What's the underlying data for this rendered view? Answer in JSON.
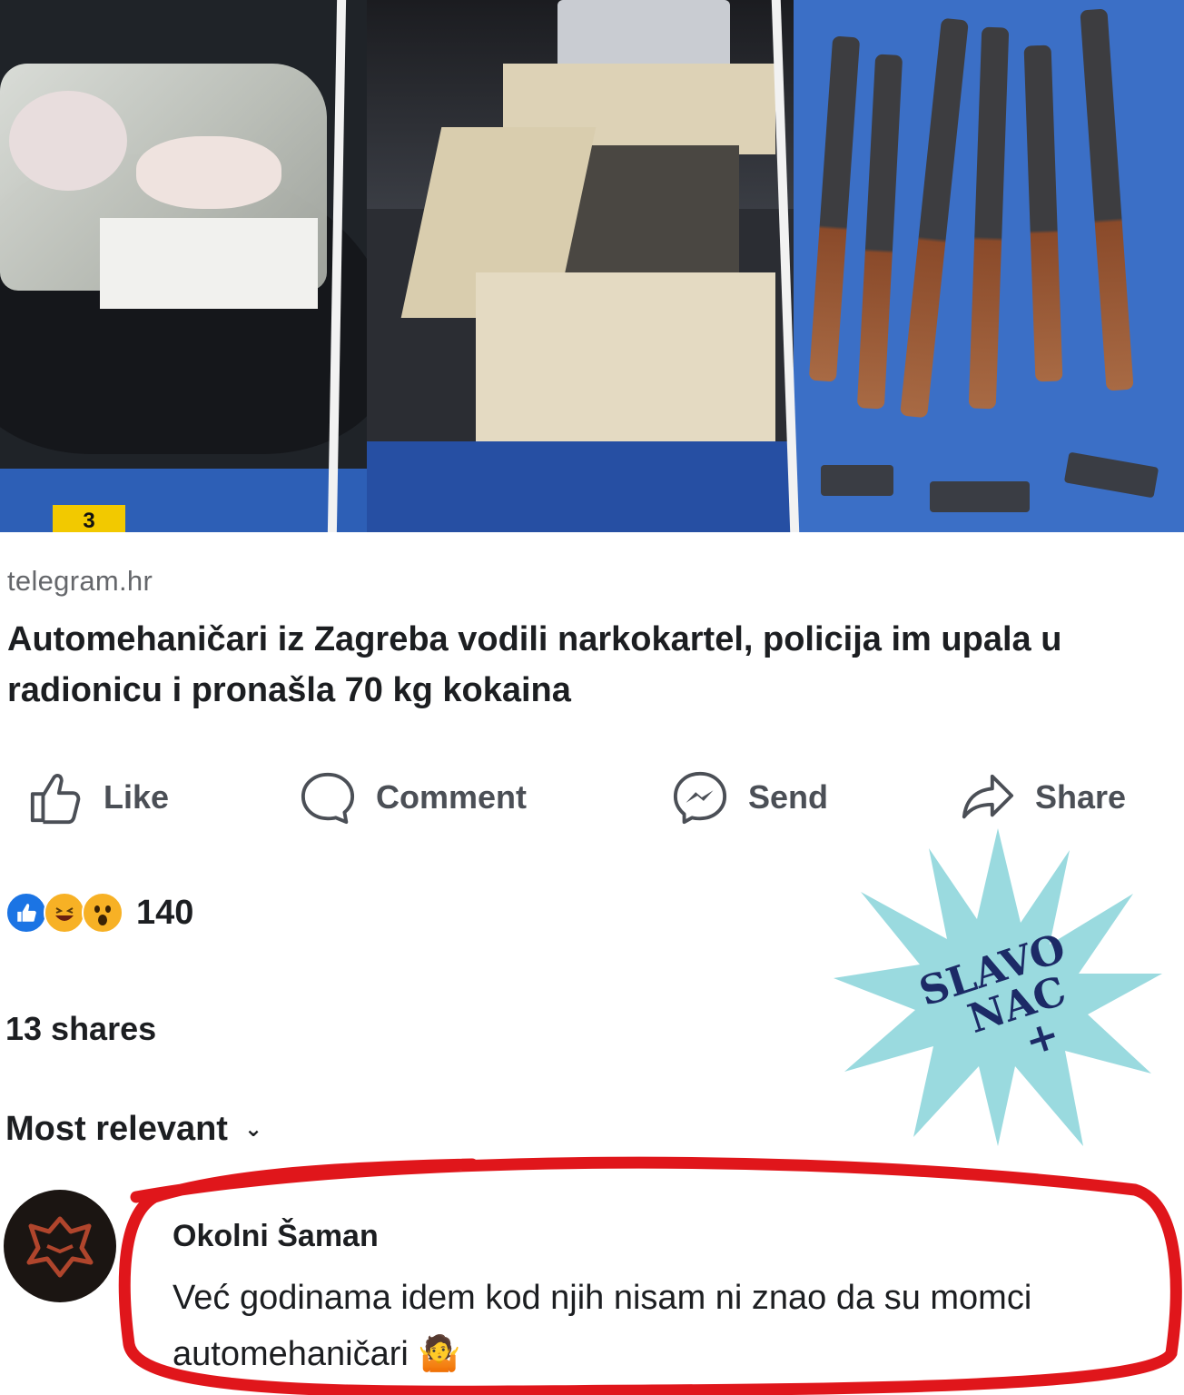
{
  "photo": {
    "evidence_tag": "3"
  },
  "link_preview": {
    "source": "telegram.hr",
    "headline": "Automehaničari iz Zagreba vodili narkokartel, policija im upala u radionicu i pronašla 70 kg kokaina"
  },
  "actions": {
    "like": "Like",
    "comment": "Comment",
    "send": "Send",
    "share": "Share"
  },
  "reactions": {
    "icons": [
      "like-reaction-icon",
      "haha-reaction-icon",
      "wow-reaction-icon"
    ],
    "count": "140"
  },
  "shares": "13 shares",
  "sort": {
    "label": "Most relevant"
  },
  "watermark": {
    "line1": "SLAVO",
    "line2": "NAC",
    "line3": "+",
    "color": "#8fd6dc"
  },
  "comment": {
    "author": "Okolni Šaman",
    "text": "Već godinama idem kod njih nisam ni znao da su momci automehaničari",
    "emoji": "🤷"
  },
  "colors": {
    "text": "#1c1e21",
    "muted": "#65676b",
    "like_blue": "#1b74e4",
    "highlight_circle": "#e0161b"
  }
}
